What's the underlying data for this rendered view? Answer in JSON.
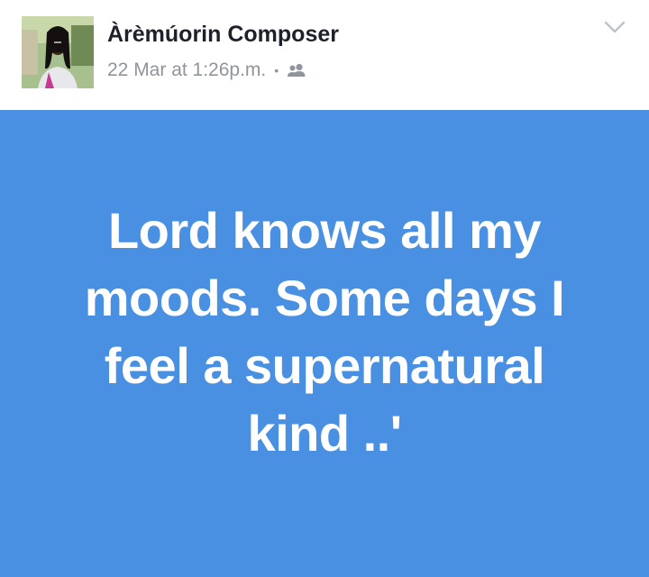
{
  "post": {
    "author_name": "Àrèmúorin Composer",
    "timestamp": "22 Mar at 1:26p.m.",
    "separator": "•",
    "audience_icon": "friends-icon",
    "menu_icon": "chevron-down-icon",
    "avatar_icon": "profile-photo",
    "status_text": "Lord knows all my moods. Some days I feel a supernatural kind ..'",
    "card_color": "#4a90e2",
    "text_color": "#ffffff"
  }
}
